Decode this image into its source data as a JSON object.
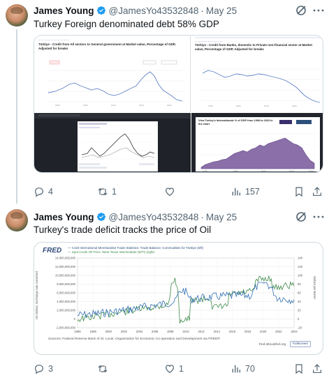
{
  "tweets": [
    {
      "author": {
        "name": "James Young",
        "handle": "@JamesYo43532848",
        "date": "May 25"
      },
      "text": "Turkey Foreign denominated debt 58% GDP",
      "media": {
        "panel1": {
          "title": "Türkiye - Credit from All sectors to General government at Market value, Percentage of GDP, Adjusted for breaks"
        },
        "panel2": {
          "title": "Türkiye - Credit from Banks, domestic to Private non-financial sector at Market value, Percentage of GDP, Adjusted for breaks"
        },
        "panel4": {
          "title": "View Turkey's Internationale % of GDP from 1998 to 2023 in the chart"
        }
      },
      "actions": {
        "replies": "4",
        "retweets": "1",
        "likes": "",
        "views": "157"
      }
    },
    {
      "author": {
        "name": "James Young",
        "handle": "@JamesYo43532848",
        "date": "May 25"
      },
      "text": "Turkey's trade deficit tracks the price of Oil",
      "media": {
        "logo": "FRED",
        "legend": [
          "— C119 International Merchandise Trade Statistics: Trade Balance: Commodities for Türkiye (left)",
          "— Spot Crude Oil Price: West Texas Intermediate (WTI) (right)"
        ],
        "left_axis_label": "US Dollars, Exchange rate converted",
        "right_axis_label": "Dollars per Barrel",
        "sources": "Sources: Federal Reserve Bank of St. Louis; Organization for Economic Co-operation and Development via FRED®",
        "url": "fred.stlouisfed.org",
        "fullscreen": "Fullscreen"
      },
      "actions": {
        "replies": "3",
        "retweets": "",
        "likes": "1",
        "views": "70"
      }
    }
  ],
  "chart_data": {
    "type": "line",
    "title": "",
    "x": [
      "1996",
      "1998",
      "2000",
      "2002",
      "2004",
      "2006",
      "2008",
      "2010",
      "2012",
      "2014",
      "2016",
      "2018",
      "2020",
      "2022",
      "2024"
    ],
    "left_ticks": [
      "14,000,000,000",
      "12,000,000,000",
      "10,000,000,000",
      "8,000,000,000",
      "6,000,000,000",
      "4,000,000,000",
      "2,000,000,000",
      "0",
      "-2,000,000,000"
    ],
    "right_ticks": [
      "140",
      "120",
      "100",
      "80",
      "60",
      "40",
      "20",
      "0",
      "-20"
    ],
    "xlabel": "",
    "ylabel": "US Dollars, Exchange rate converted",
    "y2label": "Dollars per Barrel",
    "series": [
      {
        "name": "C119 International Merchandise Trade Statistics: Trade Balance: Commodities for Türkiye (left)",
        "color": "#2f6db5"
      },
      {
        "name": "Spot Crude Oil Price: West Texas Intermediate (WTI) (right)",
        "color": "#3f8a4c"
      }
    ]
  },
  "colors": {
    "accent": "#1d9bf0",
    "muted": "#536471",
    "text": "#0f1419"
  }
}
